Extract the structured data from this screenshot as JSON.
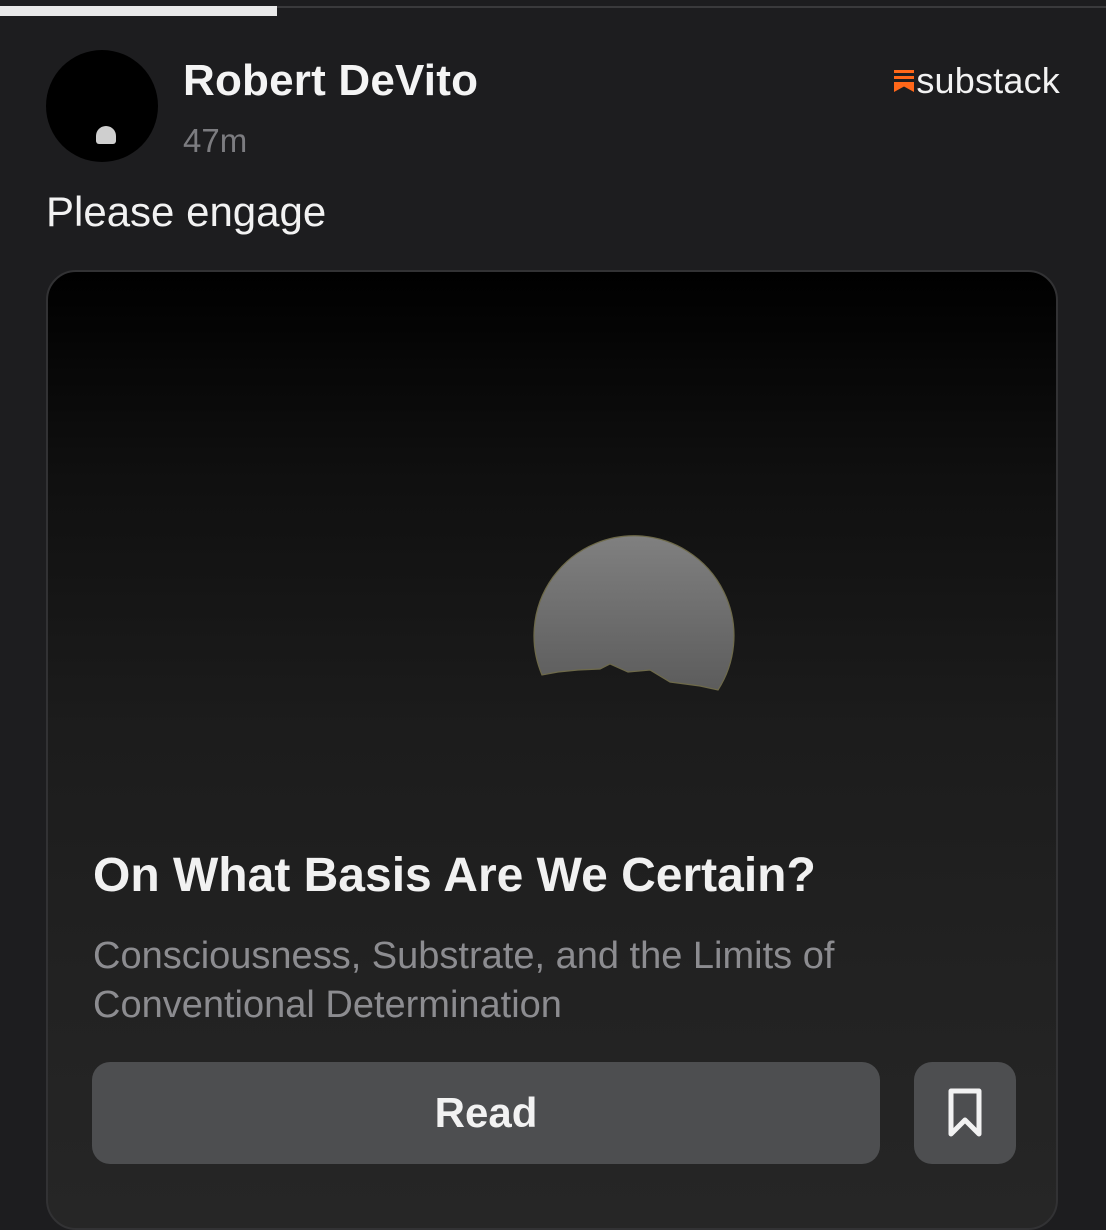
{
  "reading_progress": 0.25,
  "post": {
    "author_name": "Robert DeVito",
    "timestamp": "47m",
    "source_name": "substack",
    "text": "Please engage"
  },
  "article": {
    "title": "On What Basis Are We Certain?",
    "subtitle": "Consciousness, Substrate, and the Limits of Conventional Determination",
    "read_label": "Read"
  },
  "icons": {
    "avatar": "avatar-moon-icon",
    "source": "substack-logo-icon",
    "bookmark": "bookmark-icon"
  },
  "colors": {
    "substack_brand": "#ff6719",
    "button_bg": "#4d4e50",
    "background": "#1d1d1f"
  }
}
